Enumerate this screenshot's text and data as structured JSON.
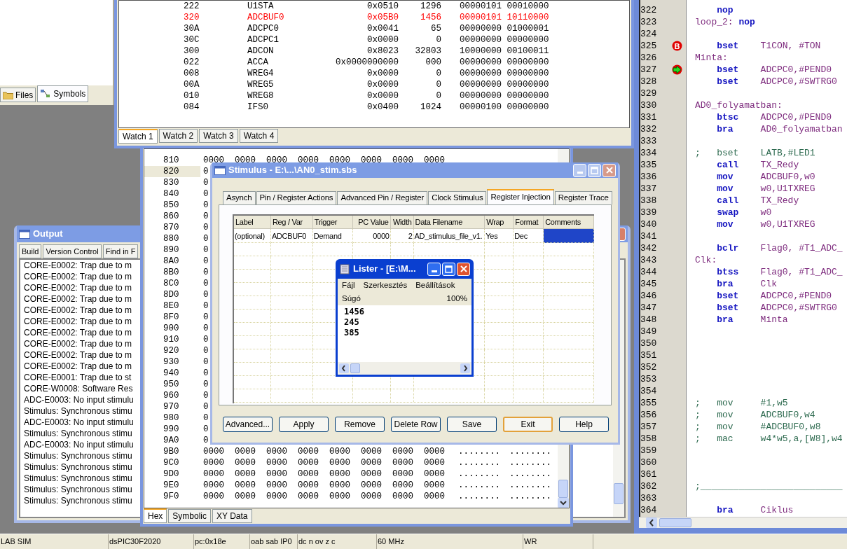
{
  "files_panel": {
    "tabs": [
      {
        "label": "Files",
        "selected": false
      },
      {
        "label": "Symbols",
        "selected": true
      }
    ]
  },
  "watch": {
    "rows": [
      {
        "address": "222",
        "symbol": "U1STA",
        "hex": "0x0510",
        "decimal": "1296",
        "binary": "00000101 00010000",
        "changed": false
      },
      {
        "address": "320",
        "symbol": "ADCBUF0",
        "hex": "0x05B0",
        "decimal": "1456",
        "binary": "00000101 10110000",
        "changed": true
      },
      {
        "address": "30A",
        "symbol": "ADCPC0",
        "hex": "0x0041",
        "decimal": "65",
        "binary": "00000000 01000001",
        "changed": false
      },
      {
        "address": "30C",
        "symbol": "ADCPC1",
        "hex": "0x0000",
        "decimal": "0",
        "binary": "00000000 00000000",
        "changed": false
      },
      {
        "address": "300",
        "symbol": "ADCON",
        "hex": "0x8023",
        "decimal": "32803",
        "binary": "10000000 00100011",
        "changed": false
      },
      {
        "address": "022",
        "symbol": "ACCA",
        "hex": "0x0000000000",
        "decimal": "000",
        "binary": "00000000 00000000",
        "changed": false
      },
      {
        "address": "008",
        "symbol": "WREG4",
        "hex": "0x0000",
        "decimal": "0",
        "binary": "00000000 00000000",
        "changed": false
      },
      {
        "address": "00A",
        "symbol": "WREG5",
        "hex": "0x0000",
        "decimal": "0",
        "binary": "00000000 00000000",
        "changed": false
      },
      {
        "address": "010",
        "symbol": "WREG8",
        "hex": "0x0000",
        "decimal": "0",
        "binary": "00000000 00000000",
        "changed": false
      },
      {
        "address": "084",
        "symbol": "IFS0",
        "hex": "0x0400",
        "decimal": "1024",
        "binary": "00000100 00000000",
        "changed": false
      }
    ],
    "tabs": [
      {
        "label": "Watch 1",
        "selected": true
      },
      {
        "label": "Watch 2",
        "selected": false
      },
      {
        "label": "Watch 3",
        "selected": false
      },
      {
        "label": "Watch 4",
        "selected": false
      }
    ]
  },
  "memory": {
    "rows": [
      {
        "address": "810",
        "selected": false,
        "words": [
          "0000",
          "0000",
          "0000",
          "0000",
          "0000",
          "0000",
          "0000",
          "0000"
        ]
      },
      {
        "address": "820",
        "selected": true,
        "words": [
          "0"
        ]
      },
      {
        "address": "830",
        "selected": false,
        "words": [
          "0"
        ]
      },
      {
        "address": "840",
        "selected": false,
        "words": [
          "0"
        ]
      },
      {
        "address": "850",
        "selected": false,
        "words": [
          "0"
        ]
      },
      {
        "address": "860",
        "selected": false,
        "words": [
          "0"
        ]
      },
      {
        "address": "870",
        "selected": false,
        "words": [
          "0"
        ]
      },
      {
        "address": "880",
        "selected": false,
        "words": [
          "0"
        ]
      },
      {
        "address": "890",
        "selected": false,
        "words": [
          "0"
        ]
      },
      {
        "address": "8A0",
        "selected": false,
        "words": [
          "0"
        ]
      },
      {
        "address": "8B0",
        "selected": false,
        "words": [
          "0"
        ]
      },
      {
        "address": "8C0",
        "selected": false,
        "words": [
          "0"
        ]
      },
      {
        "address": "8D0",
        "selected": false,
        "words": [
          "0"
        ]
      },
      {
        "address": "8E0",
        "selected": false,
        "words": [
          "0"
        ]
      },
      {
        "address": "8F0",
        "selected": false,
        "words": [
          "0"
        ]
      },
      {
        "address": "900",
        "selected": false,
        "words": [
          "0"
        ]
      },
      {
        "address": "910",
        "selected": false,
        "words": [
          "0"
        ]
      },
      {
        "address": "920",
        "selected": false,
        "words": [
          "0"
        ]
      },
      {
        "address": "930",
        "selected": false,
        "words": [
          "0"
        ]
      },
      {
        "address": "940",
        "selected": false,
        "words": [
          "0"
        ]
      },
      {
        "address": "950",
        "selected": false,
        "words": [
          "0"
        ]
      },
      {
        "address": "960",
        "selected": false,
        "words": [
          "0"
        ]
      },
      {
        "address": "970",
        "selected": false,
        "words": [
          "0"
        ]
      },
      {
        "address": "980",
        "selected": false,
        "words": [
          "0"
        ]
      },
      {
        "address": "990",
        "selected": false,
        "words": [
          "0"
        ]
      },
      {
        "address": "9A0",
        "selected": false,
        "words": [
          "0"
        ]
      },
      {
        "address": "9B0",
        "selected": false,
        "words": [
          "0000",
          "0000",
          "0000",
          "0000",
          "0000",
          "0000",
          "0000",
          "0000"
        ],
        "ascii": [
          "........",
          "........"
        ]
      },
      {
        "address": "9C0",
        "selected": false,
        "words": [
          "0000",
          "0000",
          "0000",
          "0000",
          "0000",
          "0000",
          "0000",
          "0000"
        ],
        "ascii": [
          "........",
          "........"
        ]
      },
      {
        "address": "9D0",
        "selected": false,
        "words": [
          "0000",
          "0000",
          "0000",
          "0000",
          "0000",
          "0000",
          "0000",
          "0000"
        ],
        "ascii": [
          "........",
          "........"
        ]
      },
      {
        "address": "9E0",
        "selected": false,
        "words": [
          "0000",
          "0000",
          "0000",
          "0000",
          "0000",
          "0000",
          "0000",
          "0000"
        ],
        "ascii": [
          "........",
          "........"
        ]
      },
      {
        "address": "9F0",
        "selected": false,
        "words": [
          "0000",
          "0000",
          "0000",
          "0000",
          "0000",
          "0000",
          "0000",
          "0000"
        ],
        "ascii": [
          "........",
          "........"
        ]
      }
    ],
    "tabs": [
      {
        "label": "Hex",
        "selected": true
      },
      {
        "label": "Symbolic",
        "selected": false
      },
      {
        "label": "XY Data",
        "selected": false
      }
    ]
  },
  "output": {
    "title": "Output",
    "tabs": [
      {
        "label": "Build",
        "selected": false
      },
      {
        "label": "Version Control",
        "selected": false
      },
      {
        "label": "Find in F",
        "selected": false
      }
    ],
    "lines": [
      "CORE-E0002: Trap due to m",
      "CORE-E0002: Trap due to m",
      "CORE-E0002: Trap due to m",
      "CORE-E0002: Trap due to m",
      "CORE-E0002: Trap due to m",
      "CORE-E0002: Trap due to m",
      "CORE-E0002: Trap due to m",
      "CORE-E0002: Trap due to m",
      "CORE-E0002: Trap due to m",
      "CORE-E0002: Trap due to m",
      "CORE-E0001: Trap due to st",
      "CORE-W0008: Software Res",
      "ADC-E0003: No input stimulu",
      "Stimulus: Synchronous stimu",
      "ADC-E0003: No input stimulu",
      "Stimulus: Synchronous stimu",
      "ADC-E0003: No input stimulu",
      "Stimulus: Synchronous stimu",
      "Stimulus: Synchronous stimu",
      "Stimulus: Synchronous stimu",
      "Stimulus: Synchronous stimu",
      "Stimulus: Synchronous stimu"
    ]
  },
  "stimulus": {
    "title": "Stimulus - E:\\...\\AN0_stim.sbs",
    "tabs": [
      {
        "label": "Asynch",
        "selected": false
      },
      {
        "label": "Pin / Register Actions",
        "selected": false
      },
      {
        "label": "Advanced Pin / Register",
        "selected": false
      },
      {
        "label": "Clock Stimulus",
        "selected": false
      },
      {
        "label": "Register Injection",
        "selected": true
      },
      {
        "label": "Register Trace",
        "selected": false
      }
    ],
    "columns": [
      "Label",
      "Reg / Var",
      "Trigger",
      "PC Value",
      "Width",
      "Data Filename",
      "Wrap",
      "Format",
      "Comments"
    ],
    "rows": [
      {
        "cells": [
          {
            "text": "(optional)",
            "selected": false
          },
          {
            "text": "ADCBUF0",
            "selected": false
          },
          {
            "text": "Demand",
            "selected": false
          },
          {
            "text": "0000",
            "selected": false
          },
          {
            "text": "2",
            "selected": false
          },
          {
            "text": "AD_stimulus_file_v1.",
            "selected": false
          },
          {
            "text": "Yes",
            "selected": false
          },
          {
            "text": "Dec",
            "selected": false
          },
          {
            "selected": true
          }
        ]
      }
    ],
    "buttons": [
      {
        "label": "Advanced...",
        "default": false
      },
      {
        "label": "Apply",
        "default": false
      },
      {
        "label": "Remove",
        "default": false
      },
      {
        "label": "Delete Row",
        "default": false
      },
      {
        "label": "Save",
        "default": false
      },
      {
        "label": "Exit",
        "default": true
      },
      {
        "label": "Help",
        "default": false
      }
    ]
  },
  "lister": {
    "title": "Lister - [E:\\M...",
    "menu": [
      "Fájl",
      "Szerkesztés",
      "Beállítások"
    ],
    "menu_2": "Súgó",
    "zoom": "100%",
    "lines": [
      "1456",
      "245",
      "385"
    ]
  },
  "editor": {
    "lines": [
      {
        "number": "322",
        "op": "nop"
      },
      {
        "number": "323",
        "label": "loop_2:",
        "op": "nop"
      },
      {
        "number": "324"
      },
      {
        "number": "325",
        "marker": {
          "kind": "breakpoint",
          "glyph": "B"
        },
        "op": "bset",
        "args": "T1CON, #TON"
      },
      {
        "number": "326",
        "label": "Minta:"
      },
      {
        "number": "327",
        "marker": {
          "kind": "current"
        },
        "op": "bset",
        "args": "ADCPC0,#PEND0"
      },
      {
        "number": "328",
        "op": "bset",
        "args": "ADCPC0,#SWTRG0"
      },
      {
        "number": "329"
      },
      {
        "number": "330",
        "label": "AD0_folyamatban:"
      },
      {
        "number": "331",
        "op": "btsc",
        "args": "ADCPC0,#PEND0"
      },
      {
        "number": "332",
        "op": "bra",
        "args": "AD0_folyamatban"
      },
      {
        "number": "333"
      },
      {
        "number": "334",
        "comment": ";   bset    LATB,#LED1"
      },
      {
        "number": "335",
        "op": "call",
        "args": "TX_Redy"
      },
      {
        "number": "336",
        "op": "mov",
        "args": "ADCBUF0,w0"
      },
      {
        "number": "337",
        "op": "mov",
        "args": "w0,U1TXREG"
      },
      {
        "number": "338",
        "op": "call",
        "args": "TX_Redy"
      },
      {
        "number": "339",
        "op": "swap",
        "args": "w0"
      },
      {
        "number": "340",
        "op": "mov",
        "args": "w0,U1TXREG"
      },
      {
        "number": "341"
      },
      {
        "number": "342",
        "op": "bclr",
        "args": "Flag0, #T1_ADC_"
      },
      {
        "number": "343",
        "label": "Clk:"
      },
      {
        "number": "344",
        "op": "btss",
        "args": "Flag0, #T1_ADC_"
      },
      {
        "number": "345",
        "op": "bra",
        "args": "Clk"
      },
      {
        "number": "346",
        "op": "bset",
        "args": "ADCPC0,#PEND0"
      },
      {
        "number": "347",
        "op": "bset",
        "args": "ADCPC0,#SWTRG0"
      },
      {
        "number": "348",
        "op": "bra",
        "args": "Minta"
      },
      {
        "number": "349"
      },
      {
        "number": "350"
      },
      {
        "number": "351"
      },
      {
        "number": "352"
      },
      {
        "number": "353"
      },
      {
        "number": "354"
      },
      {
        "number": "355",
        "comment": ";   mov     #1,w5"
      },
      {
        "number": "356",
        "comment": ";   mov     ADCBUF0,w4"
      },
      {
        "number": "357",
        "comment": ";   mov     #ADCBUF0,w8"
      },
      {
        "number": "358",
        "comment": ";   mac     w4*w5,a,[W8],w4"
      },
      {
        "number": "359"
      },
      {
        "number": "360"
      },
      {
        "number": "361"
      },
      {
        "number": "362",
        "comment": ";__________________________"
      },
      {
        "number": "363"
      },
      {
        "number": "364",
        "op": "bra",
        "args": "Ciklus"
      }
    ]
  },
  "status_bar": [
    "LAB SIM",
    "dsPIC30F2020",
    "pc:0x18e",
    "oab sab IP0",
    "dc n ov z c",
    "60 MHz",
    "WR"
  ]
}
